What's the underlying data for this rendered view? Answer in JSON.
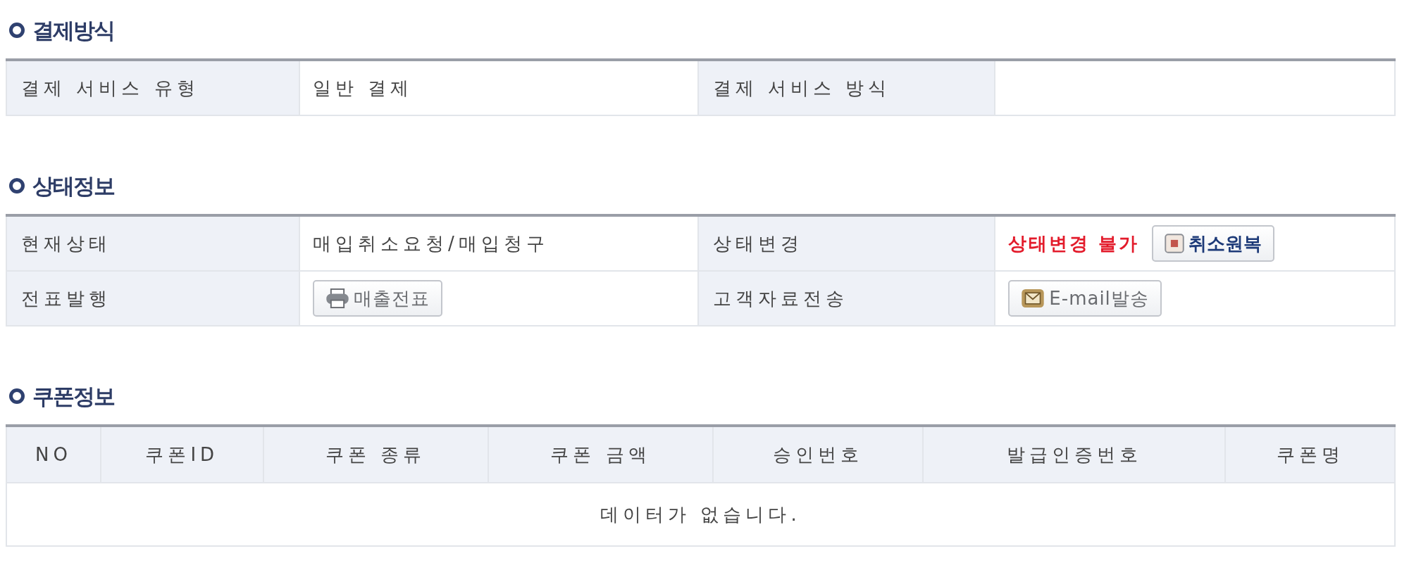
{
  "sections": [
    {
      "kind": "fields",
      "title": "결제방식",
      "rows": [
        {
          "cells": [
            {
              "label": "결제 서비스 유형",
              "value": [
                {
                  "kind": "text",
                  "text": "일반 결제"
                }
              ]
            },
            {
              "label": "결제 서비스 방식"
            }
          ]
        }
      ]
    },
    {
      "kind": "fields",
      "title": "상태정보",
      "rows": [
        {
          "cells": [
            {
              "label": "현재상태",
              "value": [
                {
                  "kind": "text",
                  "text": "매입취소요청/매입청구"
                }
              ]
            },
            {
              "label": "상태변경",
              "value": [
                {
                  "kind": "alert",
                  "text": "상태변경 불가"
                },
                {
                  "kind": "restore",
                  "text": "취소원복"
                }
              ]
            }
          ]
        },
        {
          "cells": [
            {
              "label": "전표발행",
              "value": [
                {
                  "kind": "print",
                  "text": "매출전표"
                }
              ]
            },
            {
              "label": "고객자료전송",
              "value": [
                {
                  "kind": "mail",
                  "text": "E-mail발송"
                }
              ]
            }
          ]
        }
      ]
    },
    {
      "kind": "table",
      "title": "쿠폰정보",
      "columns": [
        "NO",
        "쿠폰ID",
        "쿠폰 종류",
        "쿠폰 금액",
        "승인번호",
        "발급인증번호",
        "쿠폰명"
      ],
      "empty_message": "데이터가 없습니다."
    }
  ]
}
